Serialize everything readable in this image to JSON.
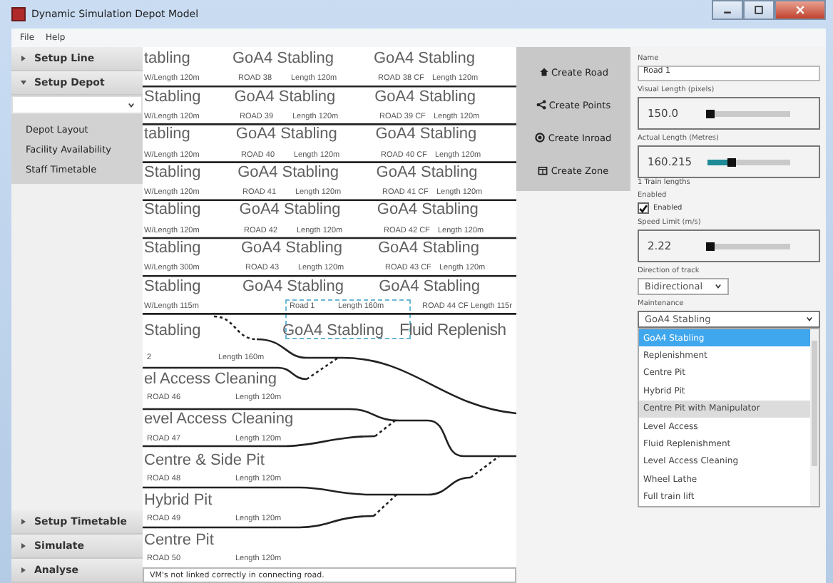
{
  "window": {
    "title": "Dynamic Simulation Depot Model"
  },
  "menu": [
    "File",
    "Help"
  ],
  "sidebar": {
    "sections_top": [
      {
        "label": "Setup Line",
        "expanded": false
      },
      {
        "label": "Setup Depot",
        "expanded": true
      }
    ],
    "items": [
      {
        "label": "Depot Layout"
      },
      {
        "label": "Facility Availability"
      },
      {
        "label": "Staff Timetable"
      }
    ],
    "sections_bottom": [
      {
        "label": "Setup Timetable",
        "expanded": false
      },
      {
        "label": "Simulate",
        "expanded": false
      },
      {
        "label": "Analyse",
        "expanded": false
      }
    ]
  },
  "canvas": {
    "roads": [
      {
        "kind": "stabling",
        "selected": false,
        "facilities": [
          "tabling",
          "GoA4 Stabling",
          "GoA4 Stabling"
        ],
        "captions": [
          "W/Length 120m",
          "ROAD 38",
          "Length 120m",
          "ROAD 38 CF",
          "Length 120m"
        ]
      },
      {
        "kind": "stabling",
        "selected": false,
        "facilities": [
          "Stabling",
          "GoA4 Stabling",
          "GoA4 Stabling"
        ],
        "captions": [
          "W/Length 120m",
          "ROAD 39",
          "Length 120m",
          "ROAD 39 CF",
          "Length 120m"
        ]
      },
      {
        "kind": "stabling",
        "selected": false,
        "facilities": [
          "tabling",
          "GoA4 Stabling",
          "GoA4 Stabling"
        ],
        "captions": [
          "W/Length 120m",
          "ROAD 40",
          "Length 120m",
          "ROAD 40 CF",
          "Length 120m"
        ]
      },
      {
        "kind": "stabling",
        "selected": false,
        "facilities": [
          "Stabling",
          "GoA4 Stabling",
          "GoA4 Stabling"
        ],
        "captions": [
          "W/Length 120m",
          "ROAD 41",
          "Length 120m",
          "ROAD 41 CF",
          "Length 120m"
        ]
      },
      {
        "kind": "stabling",
        "selected": false,
        "facilities": [
          "Stabling",
          "GoA4 Stabling",
          "GoA4 Stabling"
        ],
        "captions": [
          "W/Length 120m",
          "ROAD 42",
          "Length 120m",
          "ROAD 42 CF",
          "Length 120m"
        ]
      },
      {
        "kind": "stabling",
        "selected": false,
        "facilities": [
          "Stabling",
          "GoA4 Stabling",
          "GoA4 Stabling"
        ],
        "captions": [
          "W/Length 300m",
          "ROAD 43",
          "Length 120m",
          "ROAD 43 CF",
          "Length 120m"
        ]
      },
      {
        "kind": "stabling",
        "selected": true,
        "facilities": [
          "Stabling",
          "GoA4 Stabling",
          "GoA4 Stabling"
        ],
        "captions": [
          "W/Length 115m",
          "Road 1",
          "Length 160m",
          "ROAD 44 CF",
          "Length 115r"
        ]
      },
      {
        "kind": "junction",
        "selected": false,
        "facilities": [
          "Stabling",
          "GoA4 Stabling",
          "Fluid Replenish"
        ],
        "captions": [
          "2",
          "Length 160m"
        ]
      },
      {
        "kind": "branch",
        "selected": false,
        "facilities": [
          "el Access Cleaning"
        ],
        "captions": [
          "ROAD 46",
          "Length 120m"
        ]
      },
      {
        "kind": "branch",
        "selected": false,
        "facilities": [
          "evel Access Cleaning"
        ],
        "captions": [
          "ROAD 47",
          "Length 120m"
        ]
      },
      {
        "kind": "branch",
        "selected": false,
        "facilities": [
          "Centre & Side Pit"
        ],
        "captions": [
          "ROAD 48",
          "Length 120m"
        ]
      },
      {
        "kind": "branch",
        "selected": false,
        "facilities": [
          "Hybrid Pit"
        ],
        "captions": [
          "ROAD 49",
          "Length 120m"
        ]
      },
      {
        "kind": "branch",
        "selected": false,
        "facilities": [
          "Centre Pit"
        ],
        "captions": [
          "ROAD 50",
          "Length 120m"
        ]
      }
    ],
    "status": "VM's not linked correctly in connecting road."
  },
  "tools": [
    {
      "kind": "road",
      "label": "Create Road"
    },
    {
      "kind": "points",
      "label": "Create Points"
    },
    {
      "kind": "inroad",
      "label": "Create Inroad"
    },
    {
      "kind": "zone",
      "label": "Create Zone"
    }
  ],
  "properties": {
    "name": {
      "label": "Name",
      "value": "Road 1"
    },
    "visual_length": {
      "label": "Visual Length (pixels)",
      "value": "150.0",
      "level": 0.04
    },
    "actual_length": {
      "label": "Actual Length (Metres)",
      "value": "160.215",
      "level": 0.3,
      "note": "1 Train lengths"
    },
    "enabled": {
      "label": "Enabled",
      "checkbox_label": "Enabled",
      "checked": true
    },
    "speed_limit": {
      "label": "Speed Limit (m/s)",
      "value": "2.22",
      "level": 0.04
    },
    "direction": {
      "label": "Direction of track",
      "value": "Bidirectional"
    },
    "maintenance": {
      "label": "Maintenance",
      "value": "GoA4 Stabling",
      "options": [
        {
          "label": "GoA4 Stabling",
          "selected": true,
          "hovered": false
        },
        {
          "label": "Replenishment",
          "selected": false,
          "hovered": false
        },
        {
          "label": "Centre Pit",
          "selected": false,
          "hovered": false
        },
        {
          "label": "Hybrid Pit",
          "selected": false,
          "hovered": false
        },
        {
          "label": "Centre Pit with Manipulator",
          "selected": false,
          "hovered": true
        },
        {
          "label": "Level Access",
          "selected": false,
          "hovered": false
        },
        {
          "label": "Fluid Replenishment",
          "selected": false,
          "hovered": false
        },
        {
          "label": "Level Access Cleaning",
          "selected": false,
          "hovered": false
        },
        {
          "label": "Wheel Lathe",
          "selected": false,
          "hovered": false
        },
        {
          "label": "Full train lift",
          "selected": false,
          "hovered": false
        }
      ]
    }
  }
}
